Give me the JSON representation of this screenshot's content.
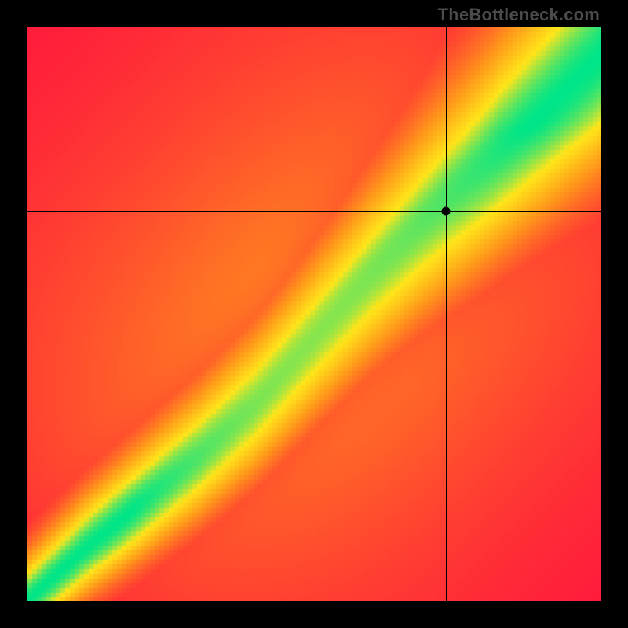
{
  "watermark": "TheBottleneck.com",
  "chart_data": {
    "type": "heatmap",
    "title": "",
    "xlabel": "",
    "ylabel": "",
    "xlim": [
      0,
      100
    ],
    "ylim": [
      0,
      100
    ],
    "grid": false,
    "legend": false,
    "marker": {
      "x": 73,
      "y": 68
    },
    "crosshair": {
      "x": 73,
      "y": 68
    },
    "optimal_curve": {
      "description": "Ridge of max compatibility (green) running diagonally; S-shaped",
      "points": [
        {
          "x": 0,
          "y": 0
        },
        {
          "x": 10,
          "y": 9
        },
        {
          "x": 20,
          "y": 17
        },
        {
          "x": 30,
          "y": 25
        },
        {
          "x": 40,
          "y": 34
        },
        {
          "x": 50,
          "y": 45
        },
        {
          "x": 60,
          "y": 56
        },
        {
          "x": 70,
          "y": 66
        },
        {
          "x": 80,
          "y": 75
        },
        {
          "x": 90,
          "y": 85
        },
        {
          "x": 100,
          "y": 95
        }
      ]
    },
    "color_scale": {
      "low": "#ff1a3c",
      "mid_low": "#ff9a1a",
      "mid": "#ffe61a",
      "high": "#00e589"
    },
    "pixelation": 6
  }
}
